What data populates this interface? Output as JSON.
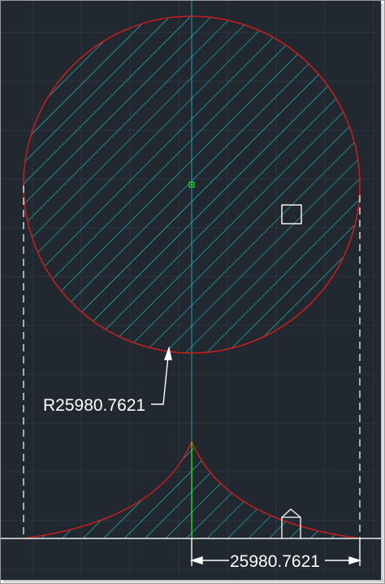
{
  "drawing": {
    "radius_dimension": "R25980.7621",
    "linear_dimension": "25980.7621"
  },
  "colors": {
    "background": "#212830",
    "grid": "#2c3440",
    "hatch": "#28c6d2",
    "outline": "#c41e1e",
    "dimension": "#ffffff",
    "axis_line": "#22e322",
    "center_line": "#1f9fb0",
    "center_marker": "#22e322"
  }
}
